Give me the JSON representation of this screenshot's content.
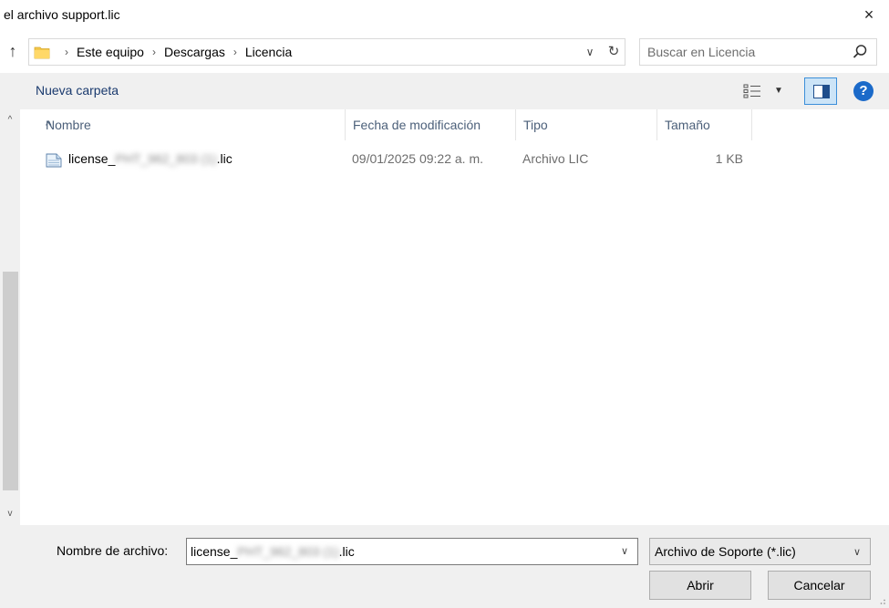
{
  "window": {
    "title": "el archivo support.lic",
    "close_icon": "×"
  },
  "navigation": {
    "up_icon": "↑",
    "breadcrumbs": [
      "Este equipo",
      "Descargas",
      "Licencia"
    ],
    "separator": "›",
    "dropdown_icon": "∨",
    "refresh_icon": "↻",
    "search_placeholder": "Buscar en Licencia"
  },
  "toolbar": {
    "new_folder_label": "Nueva carpeta",
    "view_dropdown_icon": "▼",
    "help_icon": "?"
  },
  "file_list": {
    "columns": [
      "Nombre",
      "Fecha de modificación",
      "Tipo",
      "Tamaño"
    ],
    "sort_icon": "^",
    "rows": [
      {
        "name": "license_",
        "name_obscured": "PHT_962_803 (1)",
        "name_suffix": ".lic",
        "date": "09/01/2025 09:22 a. m.",
        "type": "Archivo LIC",
        "size": "1 KB"
      }
    ]
  },
  "scrollbar": {
    "up_icon": "^",
    "down_icon": "v"
  },
  "footer": {
    "file_name_label": "Nombre de archivo:",
    "file_name_prefix": "license_",
    "file_name_obscured": "PHT_962_803 (1)",
    "file_name_suffix": ".lic",
    "file_name_dropdown_icon": "∨",
    "file_type_filter": "Archivo de Soporte (*.lic)",
    "filter_dropdown_icon": "∨",
    "open_label": "Abrir",
    "cancel_label": "Cancelar"
  },
  "colors": {
    "accent": "#1b6ac9",
    "toolbar_bg": "#f0f0f0",
    "header_text": "#4c607a",
    "secondary_text": "#6d6d6d",
    "selected_view_bg": "#cce4f7",
    "selected_view_border": "#3c8fd9"
  }
}
